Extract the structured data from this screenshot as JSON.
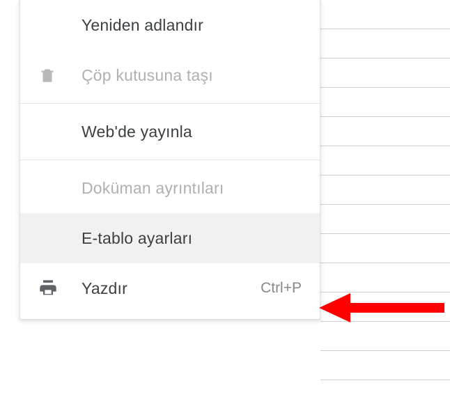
{
  "menu": {
    "items": [
      {
        "label": "Yeniden adlandır",
        "disabled": false,
        "icon": null,
        "shortcut": ""
      },
      {
        "label": "Çöp kutusuna taşı",
        "disabled": true,
        "icon": "trash",
        "shortcut": ""
      },
      {
        "label": "Web'de yayınla",
        "disabled": false,
        "icon": null,
        "shortcut": ""
      },
      {
        "label": "Doküman ayrıntıları",
        "disabled": true,
        "icon": null,
        "shortcut": ""
      },
      {
        "label": "E-tablo ayarları",
        "disabled": false,
        "icon": null,
        "shortcut": "",
        "highlighted": true
      },
      {
        "label": "Yazdır",
        "disabled": false,
        "icon": "print",
        "shortcut": "Ctrl+P"
      }
    ]
  },
  "annotation": {
    "color": "#ff0000"
  }
}
